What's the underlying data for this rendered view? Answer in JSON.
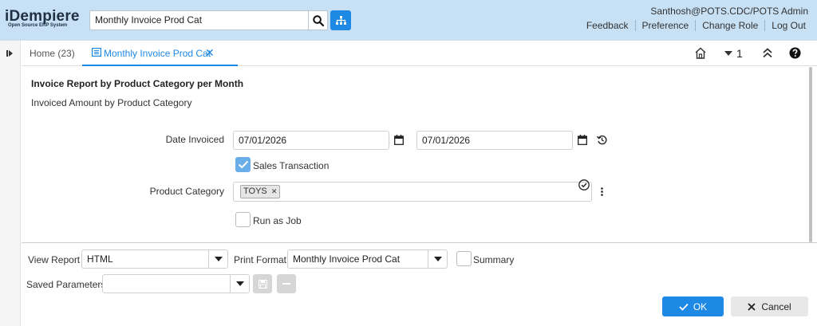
{
  "header": {
    "logo_main": "iDempiere",
    "logo_sub": "Open Source ERP System",
    "search_value": "Monthly Invoice Prod Cat",
    "user": "Santhosh@POTS.CDC/POTS Admin",
    "nav": [
      "Feedback",
      "Preference",
      "Change Role",
      "Log Out"
    ]
  },
  "tabs": {
    "home_label": "Home (23)",
    "active_label": "Monthly Invoice Prod Cat",
    "close_glyph": "✕",
    "window_count": "1"
  },
  "form": {
    "title": "Invoice Report by Product Category per Month",
    "description": "Invoiced Amount by Product Category",
    "date_invoiced_label": "Date Invoiced",
    "date_from": "07/01/2026",
    "date_to": "07/01/2026",
    "sales_transaction_label": "Sales Transaction",
    "sales_transaction_checked": true,
    "product_category_label": "Product Category",
    "product_category_chip": "TOYS",
    "chip_remove": "✕",
    "run_as_job_label": "Run as Job",
    "run_as_job_checked": false
  },
  "bottom": {
    "view_report_label": "View Report",
    "view_report_value": "HTML",
    "print_format_label": "Print Format",
    "print_format_value": "Monthly Invoice Prod Cat",
    "summary_label": "Summary",
    "saved_parameters_label": "Saved Parameters",
    "saved_parameters_value": "",
    "ok_label": "OK",
    "cancel_label": "Cancel"
  },
  "colors": {
    "header_bg": "#c7e0f4",
    "accent": "#1e88e5",
    "checked": "#6aaee9"
  }
}
